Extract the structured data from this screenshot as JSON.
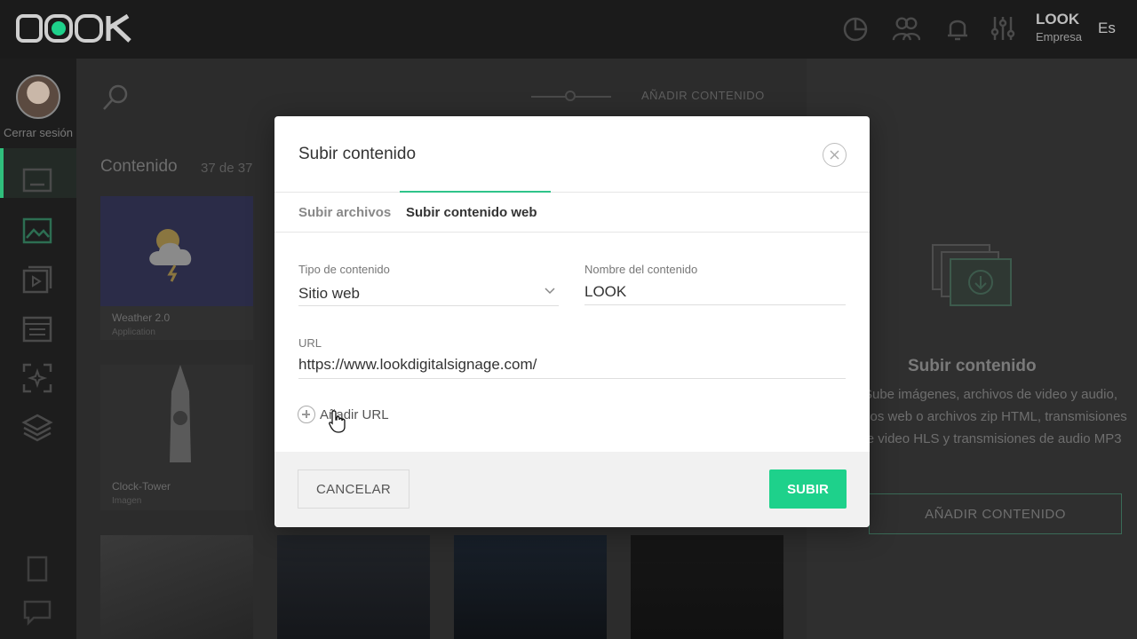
{
  "topbar": {
    "logo_text": "LOOK",
    "org_name": "LOOK",
    "org_type": "Empresa",
    "language": "Es"
  },
  "sidebar": {
    "logout_label": "Cerrar sesión"
  },
  "main": {
    "add_content_label": "AÑADIR CONTENIDO",
    "content_title": "Contenido",
    "content_count": "37 de 37",
    "cards": [
      {
        "title": "Weather 2.0",
        "subtitle": "Application"
      },
      {
        "title": "Clock-Tower",
        "subtitle": "Imagen"
      }
    ]
  },
  "right_panel": {
    "title": "Subir contenido",
    "description": "Sube imágenes, archivos de video y audio, sitios web o archivos zip HTML, transmisiones de video HLS y transmisiones de audio MP3",
    "button_label": "AÑADIR CONTENIDO"
  },
  "modal": {
    "title": "Subir contenido",
    "tabs": [
      {
        "label": "Subir archivos",
        "active": false
      },
      {
        "label": "Subir contenido web",
        "active": true
      }
    ],
    "content_type": {
      "label": "Tipo de contenido",
      "value": "Sitio web"
    },
    "content_name": {
      "label": "Nombre del contenido",
      "value": "LOOK"
    },
    "url": {
      "label": "URL",
      "value": "https://www.lookdigitalsignage.com/"
    },
    "add_url_label": "Añadir URL",
    "cancel_label": "CANCELAR",
    "submit_label": "SUBIR"
  },
  "colors": {
    "accent": "#1ed18b",
    "topbar": "#1b1b1b",
    "overlay_background": "#2c2c2c"
  }
}
